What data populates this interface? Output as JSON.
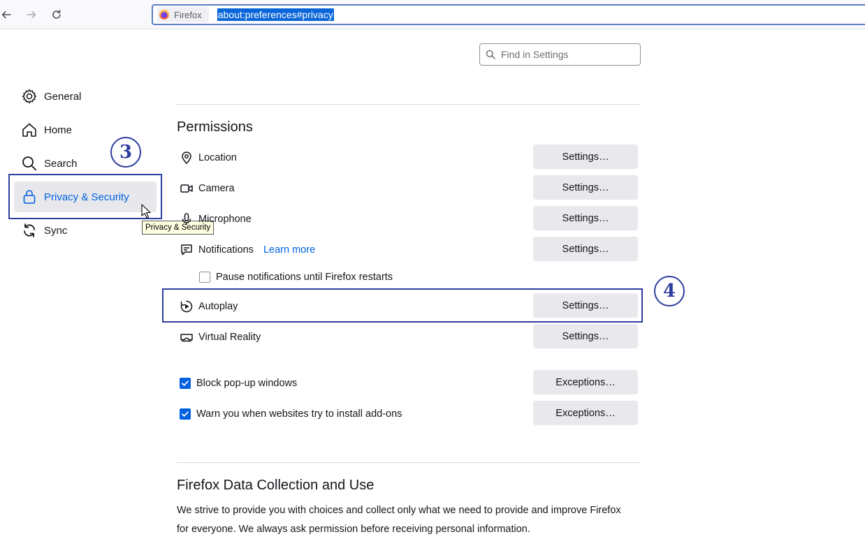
{
  "toolbar": {
    "identity_label": "Firefox",
    "url": "about:preferences#privacy"
  },
  "search": {
    "placeholder": "Find in Settings"
  },
  "sidebar": {
    "items": [
      {
        "label": "General",
        "icon": "gear-icon"
      },
      {
        "label": "Home",
        "icon": "home-icon"
      },
      {
        "label": "Search",
        "icon": "search-icon"
      },
      {
        "label": "Privacy & Security",
        "icon": "lock-icon",
        "selected": true
      },
      {
        "label": "Sync",
        "icon": "sync-icon"
      }
    ],
    "tooltip": "Privacy & Security"
  },
  "annotations": {
    "step3": "3",
    "step4": "4",
    "color": "#2e3d9e"
  },
  "permissions": {
    "title": "Permissions",
    "rows": [
      {
        "label": "Location",
        "button": "Settings…"
      },
      {
        "label": "Camera",
        "button": "Settings…"
      },
      {
        "label": "Microphone",
        "button": "Settings…"
      },
      {
        "label": "Notifications",
        "link": "Learn more",
        "button": "Settings…"
      },
      {
        "label": "Autoplay",
        "button": "Settings…"
      },
      {
        "label": "Virtual Reality",
        "button": "Settings…"
      }
    ],
    "pause_notifications": {
      "label": "Pause notifications until Firefox restarts",
      "checked": false
    },
    "block_popups": {
      "label": "Block pop-up windows",
      "checked": true,
      "button": "Exceptions…"
    },
    "warn_addons": {
      "label": "Warn you when websites try to install add-ons",
      "checked": true,
      "button": "Exceptions…"
    }
  },
  "data_collection": {
    "title": "Firefox Data Collection and Use",
    "text": "We strive to provide you with choices and collect only what we need to provide and improve Firefox for everyone. We always ask permission before receiving personal information."
  },
  "colors": {
    "accent": "#0061e0",
    "selection": "#0a66d8"
  }
}
